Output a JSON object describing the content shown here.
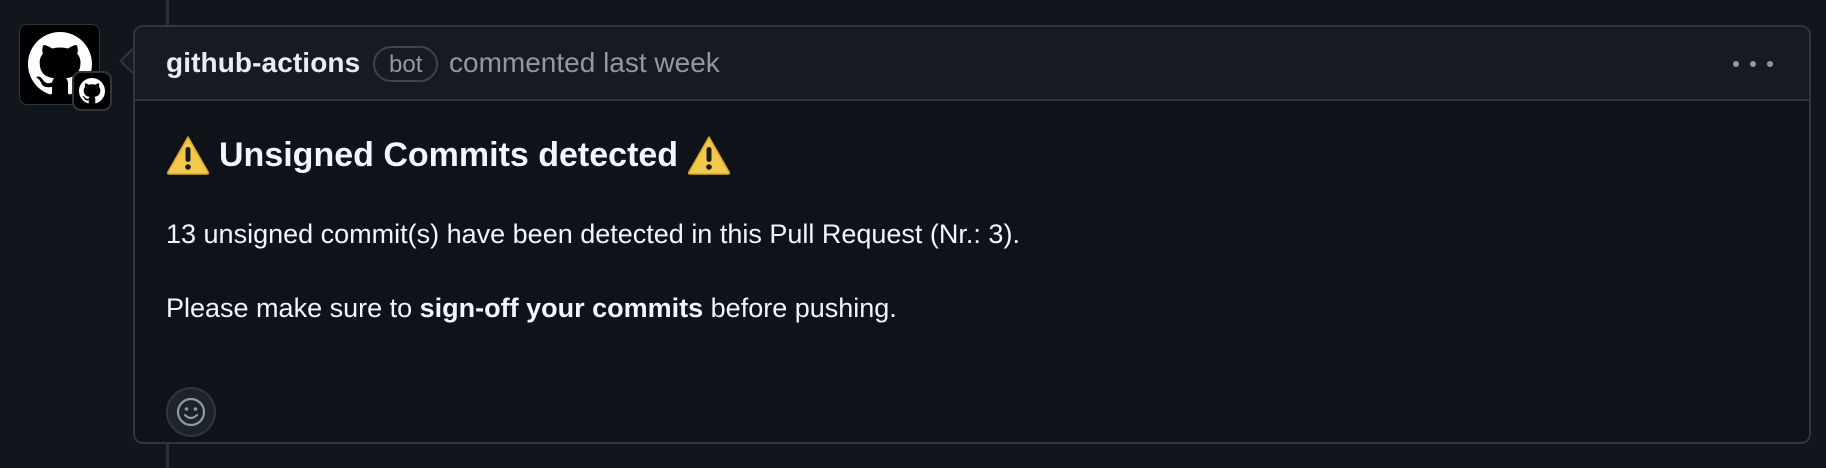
{
  "comment": {
    "author": "github-actions",
    "author_badge": "bot",
    "meta": "commented last week",
    "menu_icon": "kebab-horizontal-icon",
    "heading_text": "Unsigned Commits detected",
    "heading_icon": "warning-emoji",
    "paragraph1": "13 unsigned commit(s) have been detected in this Pull Request (Nr.: 3).",
    "paragraph2_before": "Please make sure to ",
    "paragraph2_bold": "sign-off your commits",
    "paragraph2_after": " before pushing.",
    "reaction_icon": "smiley-icon"
  },
  "avatar": {
    "icon": "github-mark-icon",
    "badge_icon": "github-mark-icon"
  },
  "colors": {
    "page_bg": "#12161c",
    "box_bg": "#0f1319",
    "header_bg": "#161b22",
    "border": "#30363d",
    "text": "#e6edf3",
    "muted": "#9198a1",
    "warning": "#f2c94c"
  }
}
